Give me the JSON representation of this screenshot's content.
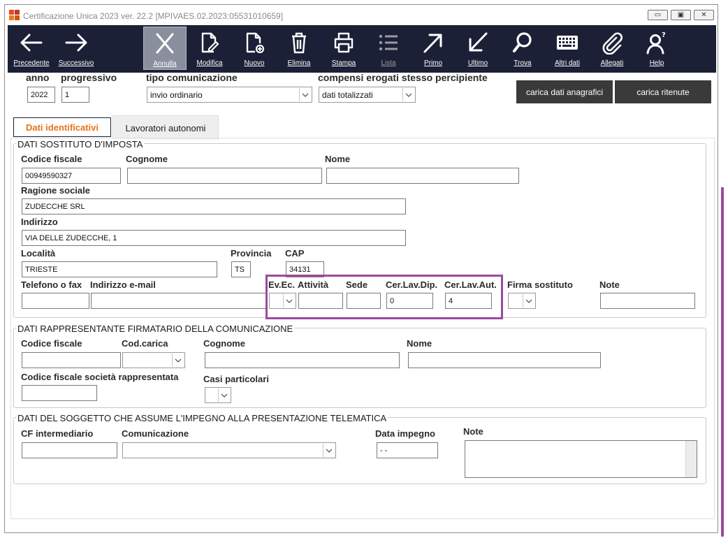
{
  "window": {
    "title": "Certificazione Unica 2023 ver. 22.2 [MPIVAES.02.2023:05531010659]",
    "logo_colors": [
      "#e84c1b",
      "#c0392b",
      "#e67e22",
      "#d35400"
    ]
  },
  "toolbar": {
    "buttons": [
      {
        "label": "Precedente",
        "icon": "arrow-left-icon"
      },
      {
        "label": "Successivo",
        "icon": "arrow-right-icon"
      },
      {
        "label": "Annulla",
        "icon": "close-icon",
        "active": true
      },
      {
        "label": "Modifica",
        "icon": "edit-document-icon"
      },
      {
        "label": "Nuovo",
        "icon": "new-document-icon"
      },
      {
        "label": "Elimina",
        "icon": "trash-icon"
      },
      {
        "label": "Stampa",
        "icon": "printer-icon"
      },
      {
        "label": "Lista",
        "icon": "list-icon",
        "disabled": true
      },
      {
        "label": "Primo",
        "icon": "arrow-up-right-icon"
      },
      {
        "label": "Ultimo",
        "icon": "arrow-down-left-icon"
      },
      {
        "label": "Trova",
        "icon": "search-icon"
      },
      {
        "label": "Altri dati",
        "icon": "keyboard-icon"
      },
      {
        "label": "Allegati",
        "icon": "paperclip-icon"
      },
      {
        "label": "Help",
        "icon": "help-user-icon"
      }
    ]
  },
  "header": {
    "anno_label": "anno",
    "anno_value": "2022",
    "progressivo_label": "progressivo",
    "progressivo_value": "1",
    "tipo_label": "tipo comunicazione",
    "tipo_value": "invio ordinario",
    "compensi_label": "compensi erogati stesso percipiente",
    "compensi_value": "dati totalizzati",
    "btn_anagrafici": "carica dati anagrafici",
    "btn_ritenute": "carica ritenute"
  },
  "tabs": {
    "dati": "Dati identificativi",
    "lavoratori": "Lavoratori autonomi"
  },
  "sostituto": {
    "title": "DATI SOSTITUTO D'IMPOSTA",
    "cf_label": "Codice fiscale",
    "cf_value": "00949590327",
    "cognome_label": "Cognome",
    "cognome_value": "",
    "nome_label": "Nome",
    "nome_value": "",
    "ragione_label": "Ragione sociale",
    "ragione_value": "ZUDECCHE SRL",
    "indirizzo_label": "Indirizzo",
    "indirizzo_value": "VIA DELLE ZUDECCHE, 1",
    "localita_label": "Località",
    "localita_value": "TRIESTE",
    "provincia_label": "Provincia",
    "provincia_value": "TS",
    "cap_label": "CAP",
    "cap_value": "34131",
    "telefono_label": "Telefono o fax",
    "email_label": "Indirizzo e-mail",
    "evec_label": "Ev.Ec.",
    "attivita_label": "Attività",
    "sede_label": "Sede",
    "cerdip_label": "Cer.Lav.Dip.",
    "cerdip_value": "0",
    "coraut_label": "Cer.Lav.Aut.",
    "coraut_value": "4",
    "firma_label": "Firma sostituto",
    "note_label": "Note"
  },
  "rappresentante": {
    "title": "DATI RAPPRESENTANTE FIRMATARIO DELLA COMUNICAZIONE",
    "cf_label": "Codice fiscale",
    "codcarica_label": "Cod.carica",
    "cognome_label": "Cognome",
    "nome_label": "Nome",
    "cfsoc_label": "Codice fiscale società rappresentata",
    "casi_label": "Casi particolari"
  },
  "telematica": {
    "title": "DATI DEL SOGGETTO CHE ASSUME L'IMPEGNO ALLA PRESENTAZIONE TELEMATICA",
    "cfint_label": "CF intermediario",
    "comunicazione_label": "Comunicazione",
    "data_label": "Data impegno",
    "data_value": "- -",
    "note_label": "Note"
  }
}
